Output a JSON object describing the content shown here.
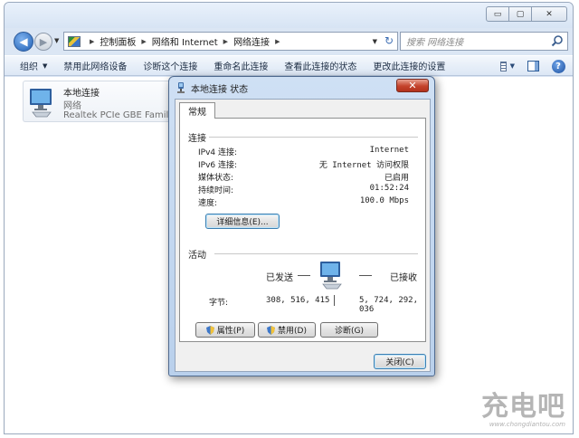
{
  "window": {
    "controls": {
      "minimize": "▭",
      "maximize": "▢",
      "close": "✕"
    }
  },
  "navbar": {
    "back": "◀",
    "forward": "▶",
    "breadcrumb": [
      "控制面板",
      "网络和 Internet",
      "网络连接"
    ],
    "search_placeholder": "搜索 网络连接"
  },
  "toolbar": {
    "items": [
      "组织",
      "禁用此网络设备",
      "诊断这个连接",
      "重命名此连接",
      "查看此连接的状态",
      "更改此连接的设置"
    ]
  },
  "adapter": {
    "name": "本地连接",
    "status": "网络",
    "device": "Realtek PCIe GBE Family C"
  },
  "dialog": {
    "title": "本地连接 状态",
    "tab": "常规",
    "connection_group": "连接",
    "rows": [
      {
        "label": "IPv4 连接:",
        "value": "Internet"
      },
      {
        "label": "IPv6 连接:",
        "value": "无 Internet 访问权限"
      },
      {
        "label": "媒体状态:",
        "value": "已启用"
      },
      {
        "label": "持续时间:",
        "value": "01:52:24"
      },
      {
        "label": "速度:",
        "value": "100.0 Mbps"
      }
    ],
    "details_button": "详细信息(E)...",
    "activity_group": "活动",
    "sent_label": "已发送",
    "received_label": "已接收",
    "bytes_label": "字节:",
    "bytes_sent": "308, 516, 415",
    "bytes_received": "5, 724, 292, 036",
    "properties_button": "属性(P)",
    "disable_button": "禁用(D)",
    "diagnose_button": "诊断(G)",
    "close_button": "关闭(C)"
  },
  "watermark": {
    "text": "充电吧",
    "url": "www.chongdiantou.com"
  }
}
